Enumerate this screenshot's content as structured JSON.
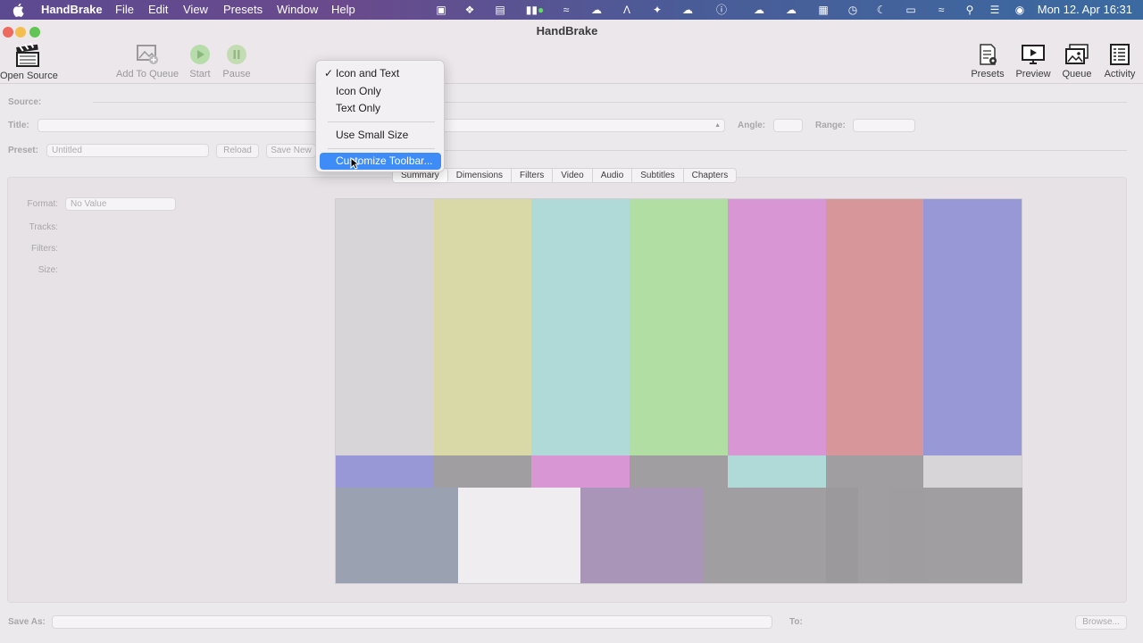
{
  "menubar": {
    "app_name": "HandBrake",
    "menus": [
      "File",
      "Edit",
      "View",
      "Presets",
      "Window",
      "Help"
    ],
    "status_icons": [
      "stop-icon",
      "dropbox-icon",
      "screen-icon",
      "battery-monitor-icon",
      "sync-icon",
      "cloud-upload-icon",
      "a-icon",
      "bird-icon",
      "cloud-icon",
      "info-icon",
      "cloud-upload-icon",
      "cloud-dark-icon",
      "grid-icon",
      "time-machine-icon",
      "moon-icon",
      "battery-icon",
      "wifi-icon",
      "search-icon",
      "control-center-icon",
      "siri-icon"
    ],
    "clock": "Mon 12. Apr  16:31"
  },
  "window": {
    "title": "HandBrake"
  },
  "toolbar": {
    "open_source": "Open Source",
    "add_to_queue": "Add To Queue",
    "start": "Start",
    "pause": "Pause",
    "presets": "Presets",
    "preview": "Preview",
    "queue": "Queue",
    "activity": "Activity"
  },
  "form": {
    "source_label": "Source:",
    "title_label": "Title:",
    "angle_label": "Angle:",
    "range_label": "Range:",
    "preset_label": "Preset:",
    "preset_value": "Untitled",
    "reload_button": "Reload",
    "save_new_button": "Save New"
  },
  "tabs": [
    "Summary",
    "Dimensions",
    "Filters",
    "Video",
    "Audio",
    "Subtitles",
    "Chapters"
  ],
  "active_tab": "Summary",
  "summary": {
    "format_label": "Format:",
    "format_value": "No Value",
    "tracks_label": "Tracks:",
    "filters_label": "Filters:",
    "size_label": "Size:"
  },
  "bottom": {
    "save_as_label": "Save As:",
    "to_label": "To:",
    "browse_button": "Browse..."
  },
  "context_menu": {
    "items": [
      "Icon and Text",
      "Icon Only",
      "Text Only",
      "Use Small Size",
      "Customize Toolbar..."
    ],
    "checked_item": "Icon and Text",
    "highlighted_item": "Customize Toolbar..."
  },
  "colors": {
    "menu_highlight": "#3e8cf7",
    "top_bars": [
      "#d7d5d7",
      "#d9d9a7",
      "#b0dad8",
      "#b0dea3",
      "#d897d4",
      "#d79699",
      "#9898d7"
    ],
    "middle_bars": [
      "#9898d7",
      "#a09ea0",
      "#d897d4",
      "#a09ea0",
      "#b0dad8",
      "#a09ea0",
      "#d7d5d7"
    ],
    "bottom_bars": [
      "#9aa1b0",
      "#efedef",
      "#a895b8",
      "#a09ea0",
      "#9b999b",
      "#a09ea0",
      "#9f9d9f",
      "#a09ea0"
    ]
  }
}
